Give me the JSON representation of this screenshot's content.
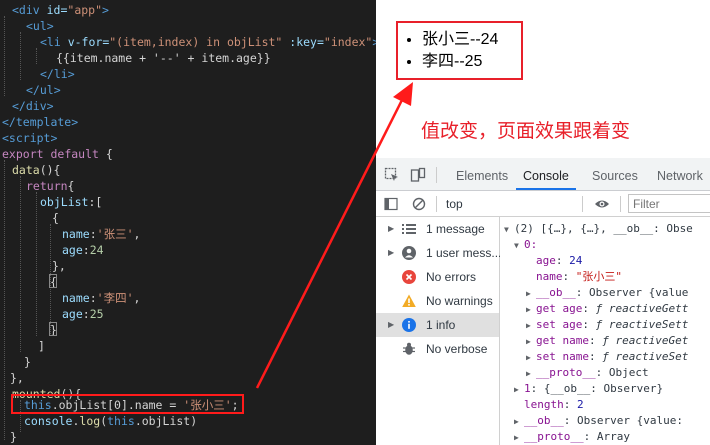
{
  "editor": {
    "lines": {
      "l1": {
        "t1": "<div",
        "t2": " id=",
        "t3": "\"app\"",
        "t4": ">"
      },
      "l2": {
        "t1": "<ul>"
      },
      "l3": {
        "t1": "<li",
        "t2": " v-for=",
        "t3": "\"(item,index) in objList\"",
        "t4": " :key=",
        "t5": "\"index\"",
        "t6": ">"
      },
      "l4": {
        "t1": "{{item.name + '--' + item.age}}"
      },
      "l5": {
        "t1": "</li>"
      },
      "l6": {
        "t1": "</ul>"
      },
      "l7": {
        "t1": "</div>"
      },
      "l8": {
        "t1": "</template>"
      },
      "l9": {
        "t1": "<script>"
      },
      "l10": {
        "t1": "export",
        "t2": " default",
        "t3": " {"
      },
      "l11": {
        "t1": "data",
        "t2": "(){"
      },
      "l12": {
        "t1": "return",
        "t2": "{"
      },
      "l13": {
        "t1": "objList",
        "t2": ":["
      },
      "l14": {
        "t1": "{"
      },
      "l15": {
        "t1": "name",
        "t2": ":",
        "t3": "'张三'",
        "t4": ","
      },
      "l16": {
        "t1": "age",
        "t2": ":",
        "t3": "24"
      },
      "l17": {
        "t1": "},"
      },
      "l18": {
        "t1": "{"
      },
      "l19": {
        "t1": "name",
        "t2": ":",
        "t3": "'李四'",
        "t4": ","
      },
      "l20": {
        "t1": "age",
        "t2": ":",
        "t3": "25"
      },
      "l21": {
        "t1": "}"
      },
      "l22": {
        "t1": "]"
      },
      "l23": {
        "t1": "}"
      },
      "l24": {
        "t1": "},"
      },
      "l25": {
        "t1": "mounted",
        "t2": "(){"
      },
      "l26": {
        "t1": "this",
        "t2": ".objList[0].name = ",
        "t3": "'张小三'",
        "t4": ";"
      },
      "l27": {
        "t1": "console",
        "t2": ".",
        "t3": "log",
        "t4": "(",
        "t5": "this",
        "t6": ".objList)"
      },
      "l28": {
        "t1": "}"
      }
    }
  },
  "rendered": {
    "items": [
      "张小三--24",
      "李四--25"
    ],
    "note": "值改变，页面效果跟着变"
  },
  "devtools": {
    "tabs": [
      "Elements",
      "Console",
      "Sources",
      "Network"
    ],
    "active_tab": "Console",
    "context": "top",
    "filter_placeholder": "Filter",
    "sidebar": [
      {
        "label": "1 message",
        "icon": "list-icon"
      },
      {
        "label": "1 user mess...",
        "icon": "user-icon"
      },
      {
        "label": "No errors",
        "icon": "error-icon"
      },
      {
        "label": "No warnings",
        "icon": "warning-icon"
      },
      {
        "label": "1 info",
        "icon": "info-icon"
      },
      {
        "label": "No verbose",
        "icon": "bug-icon"
      }
    ],
    "console_lines": {
      "c1": "(2) [{…}, {…}, __ob__: Obse",
      "c2": "0:",
      "c3_key": "age",
      "c3_val": "24",
      "c4_key": "name",
      "c4_val": "\"张小三\"",
      "c5_key": "__ob__",
      "c5_val": "Observer {value",
      "c6_key": "get age",
      "c6_val": "ƒ reactiveGett",
      "c7_key": "set age",
      "c7_val": "ƒ reactiveSett",
      "c8_key": "get name",
      "c8_val": "ƒ reactiveGet",
      "c9_key": "set name",
      "c9_val": "ƒ reactiveSet",
      "c10_key": "__proto__",
      "c10_val": "Object",
      "c11_key": "1",
      "c11_val": "{__ob__: Observer}",
      "c12_key": "length",
      "c12_val": "2",
      "c13_key": "__ob__",
      "c13_val": "Observer {value: ",
      "c14_key": "__proto__",
      "c14_val": "Array"
    }
  },
  "colors": {
    "highlight": "#ff1b1b",
    "note": "#e8202a",
    "editor_bg": "#1e1e1e",
    "tab_active": "#1a73e8"
  }
}
